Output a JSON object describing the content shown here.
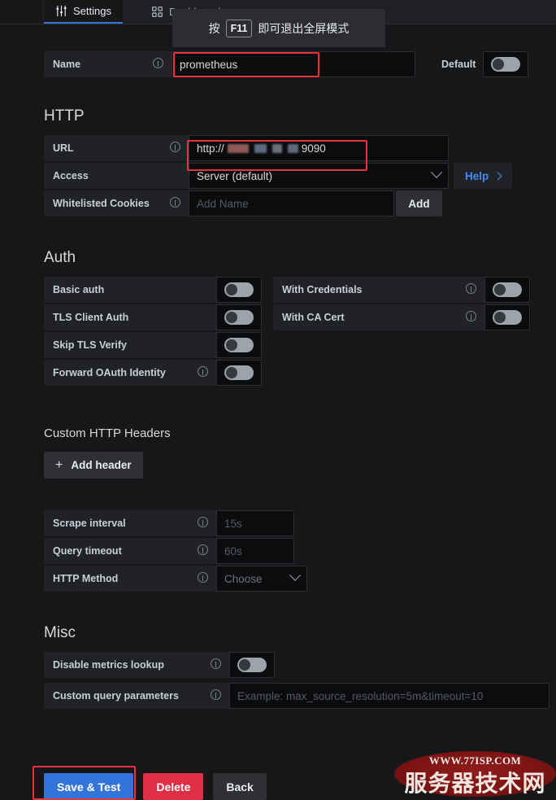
{
  "tabs": [
    {
      "label": "Settings",
      "icon": "sliders-icon",
      "active": true
    },
    {
      "label": "Dashboards",
      "icon": "grid-icon",
      "active": false
    }
  ],
  "fullscreen_toast": {
    "prefix": "按",
    "key": "F11",
    "suffix": "即可退出全屏模式"
  },
  "name_row": {
    "label": "Name",
    "value": "prometheus",
    "default_label": "Default",
    "default_toggle": "off"
  },
  "http": {
    "title": "HTTP",
    "url": {
      "label": "URL",
      "prefix": "http://",
      "redacted": true,
      "suffix": "9090"
    },
    "access": {
      "label": "Access",
      "value": "Server (default)",
      "help_label": "Help"
    },
    "cookies": {
      "label": "Whitelisted Cookies",
      "placeholder": "Add Name",
      "value": "",
      "add_label": "Add"
    }
  },
  "auth": {
    "title": "Auth",
    "rows": [
      {
        "label": "Basic auth",
        "info": false,
        "toggle": "off"
      },
      {
        "label": "TLS Client Auth",
        "info": false,
        "toggle": "off"
      },
      {
        "label": "Skip TLS Verify",
        "info": false,
        "toggle": "off"
      },
      {
        "label": "Forward OAuth Identity",
        "info": true,
        "toggle": "off"
      }
    ],
    "right_rows": [
      {
        "label": "With Credentials",
        "info": true,
        "toggle": "off"
      },
      {
        "label": "With CA Cert",
        "info": true,
        "toggle": "off"
      }
    ]
  },
  "custom_headers": {
    "title": "Custom HTTP Headers",
    "add_label": "Add header"
  },
  "prometheus": {
    "scrape_interval": {
      "label": "Scrape interval",
      "placeholder": "15s",
      "value": ""
    },
    "query_timeout": {
      "label": "Query timeout",
      "placeholder": "60s",
      "value": ""
    },
    "http_method": {
      "label": "HTTP Method",
      "placeholder": "Choose",
      "value": ""
    }
  },
  "misc": {
    "title": "Misc",
    "disable_metrics_lookup": {
      "label": "Disable metrics lookup",
      "toggle": "off"
    },
    "custom_query_parameters": {
      "label": "Custom query parameters",
      "placeholder": "Example: max_source_resolution=5m&timeout=10",
      "value": ""
    }
  },
  "actions": {
    "save": "Save & Test",
    "delete": "Delete",
    "back": "Back"
  },
  "watermark": {
    "url": "WWW.77ISP.COM",
    "text": "服务器技术网"
  },
  "colors": {
    "background": "#161719",
    "panel": "#202226",
    "input": "#0b0c0e",
    "accent_blue": "#3274d9",
    "link_blue": "#3d8bfd",
    "danger_red": "#e02f44",
    "highlight_red": "#e8333f",
    "watermark_red": "#7d1414"
  }
}
